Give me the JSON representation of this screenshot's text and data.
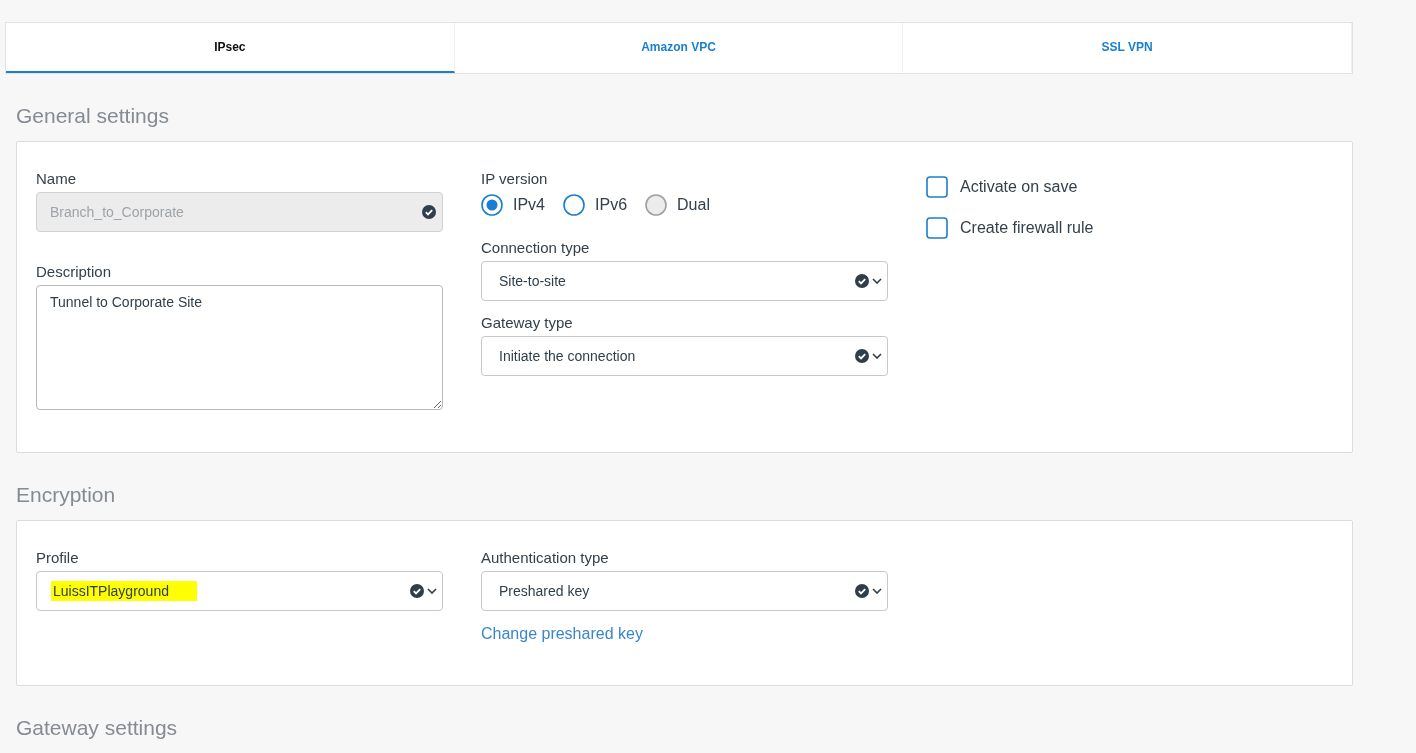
{
  "tabs": [
    {
      "label": "IPsec",
      "selected": true
    },
    {
      "label": "Amazon VPC",
      "selected": false
    },
    {
      "label": "SSL VPN",
      "selected": false
    }
  ],
  "general_settings": {
    "heading": "General settings",
    "name": {
      "label": "Name",
      "value": "Branch_to_Corporate",
      "disabled": true
    },
    "description": {
      "label": "Description",
      "value": "Tunnel to Corporate Site"
    },
    "ip_version": {
      "label": "IP version",
      "options": [
        {
          "label": "IPv4",
          "selected": true,
          "disabled": false
        },
        {
          "label": "IPv6",
          "selected": false,
          "disabled": false
        },
        {
          "label": "Dual",
          "selected": false,
          "disabled": true
        }
      ]
    },
    "connection_type": {
      "label": "Connection type",
      "value": "Site-to-site"
    },
    "gateway_type": {
      "label": "Gateway type",
      "value": "Initiate the connection"
    },
    "checkboxes": [
      {
        "label": "Activate on save",
        "checked": false
      },
      {
        "label": "Create firewall rule",
        "checked": false
      }
    ]
  },
  "encryption": {
    "heading": "Encryption",
    "profile": {
      "label": "Profile",
      "value": "LuissITPlayground",
      "highlighted": true
    },
    "authentication_type": {
      "label": "Authentication type",
      "value": "Preshared key"
    },
    "link": "Change preshared key"
  },
  "gateway_settings": {
    "heading": "Gateway settings"
  }
}
